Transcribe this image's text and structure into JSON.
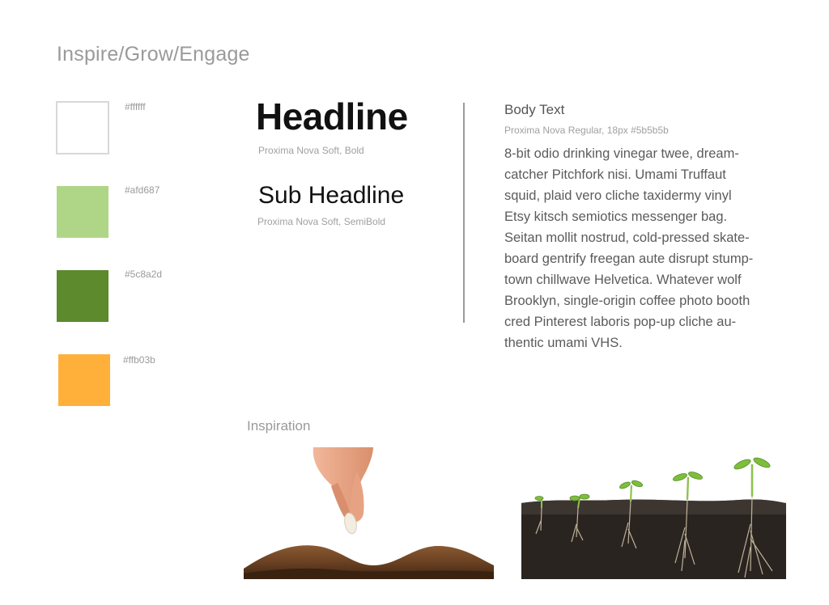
{
  "page": {
    "title": "Inspire/Grow/Engage"
  },
  "palette": [
    {
      "hex": "#ffffff",
      "label": "#ffffff"
    },
    {
      "hex": "#afd687",
      "label": "#afd687"
    },
    {
      "hex": "#5c8a2d",
      "label": "#5c8a2d"
    },
    {
      "hex": "#ffb03b",
      "label": "#ffb03b"
    }
  ],
  "typography": {
    "headline": {
      "text": "Headline",
      "font_note": "Proxima Nova Soft, Bold"
    },
    "subheadline": {
      "text": "Sub Headline",
      "font_note": "Proxima Nova Soft, SemiBold"
    },
    "body": {
      "title": "Body Text",
      "spec": "Proxima Nova Regular, 18px #5b5b5b",
      "lines": [
        "8-bit odio drinking vinegar twee, dream-",
        "catcher Pitchfork nisi. Umami Truffaut",
        "squid, plaid vero cliche taxidermy vinyl",
        "Etsy kitsch semiotics messenger bag.",
        "Seitan mollit nostrud, cold-pressed skate-",
        "board gentrify freegan aute disrupt stump-",
        "town chillwave Helvetica. Whatever wolf",
        "Brooklyn, single-origin coffee photo booth",
        "cred Pinterest laboris pop-up cliche au-",
        "thentic umami VHS."
      ]
    }
  },
  "inspiration": {
    "label": "Inspiration"
  }
}
